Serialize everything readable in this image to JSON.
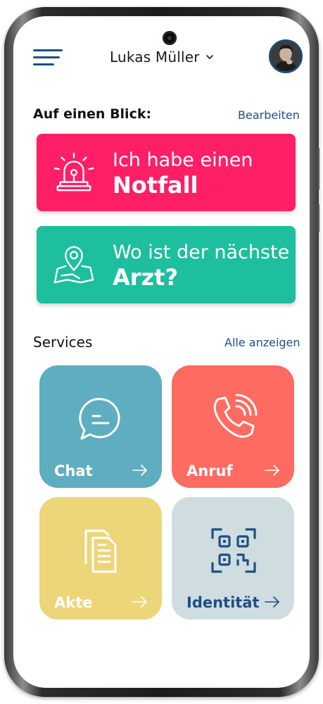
{
  "header": {
    "user_name": "Lukas Müller",
    "menu_icon": "hamburger-menu-icon",
    "dropdown_icon": "chevron-down-icon",
    "avatar": "user-avatar"
  },
  "overview": {
    "title": "Auf einen Blick:",
    "edit_link": "Bearbeiten",
    "emergency": {
      "line1": "Ich habe einen",
      "line2": "Notfall",
      "color": "#ff1f66",
      "icon": "siren-icon"
    },
    "doctor": {
      "line1": "Wo ist der nächste",
      "line2": "Arzt?",
      "color": "#1dbf9e",
      "icon": "map-pin-icon"
    }
  },
  "services": {
    "title": "Services",
    "all_link": "Alle anzeigen",
    "tiles": [
      {
        "label": "Chat",
        "color": "#5fadc0",
        "icon": "chat-bubble-icon"
      },
      {
        "label": "Anruf",
        "color": "#fd6b61",
        "icon": "phone-call-icon"
      },
      {
        "label": "Akte",
        "color": "#edd57a",
        "icon": "documents-icon"
      },
      {
        "label": "Identität",
        "color": "#cfdde0",
        "icon": "qr-code-icon"
      }
    ]
  }
}
